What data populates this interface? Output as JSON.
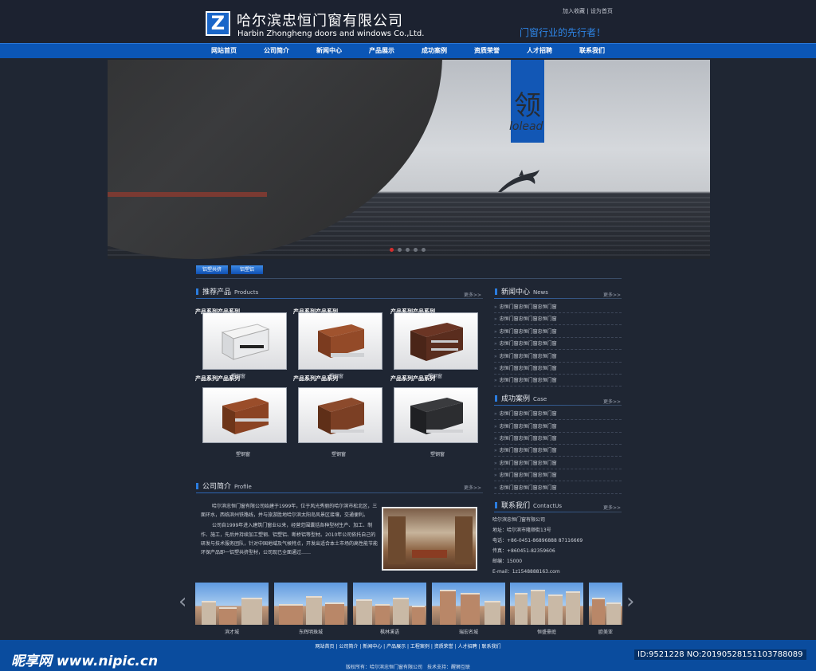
{
  "header": {
    "logo_letter": "Z",
    "company_cn": "哈尔滨忠恒门窗有限公司",
    "company_en": "Harbin Zhongheng doors and windows Co.,Ltd.",
    "top_link_1": "加入收藏",
    "top_link_sep": "|",
    "top_link_2": "设为首页",
    "slogan": "门窗行业的先行者！"
  },
  "nav": {
    "items": [
      "网站首页",
      "公司简介",
      "新闻中心",
      "产品展示",
      "成功案例",
      "资质荣誉",
      "人才招聘",
      "联系我们"
    ]
  },
  "banner": {
    "lead_glyph": "领",
    "lead_text": "lolead"
  },
  "tabs": [
    "铝塑共挤",
    "铝塑铝"
  ],
  "products": {
    "title": "推荐产品",
    "title_en": "Products",
    "more": "更多>>",
    "series_label": "产品系列产品系列",
    "items": [
      {
        "label": "产品系列产品系列",
        "caption": "塑钢窗"
      },
      {
        "label": "产品系列产品系列",
        "caption": "塑钢窗"
      },
      {
        "label": "产品系列产品系列",
        "caption": "塑钢窗"
      },
      {
        "label": "产品系列产品系列",
        "caption": "塑钢窗"
      },
      {
        "label": "产品系列产品系列",
        "caption": "塑钢窗"
      },
      {
        "label": "产品系列产品系列",
        "caption": "塑钢窗"
      }
    ]
  },
  "profile": {
    "title": "公司简介",
    "title_en": "Profile",
    "more": "更多>>",
    "para1": "哈尔滨忠恒门窗有限公司始建于1999年，位于风光秀丽的哈尔滨市松北区，三面环水，西临滨州铁路线，并与旅游胜地哈尔滨太阳岛风景区接壤，交通便利。",
    "para2": "公司自1999年进入建筑门窗业以来，经营范围囊括各种型材生产、加工、制作、施工，先后并持续加工塑钢、铝塑铝、断桥铝等型材。2010年公司依托自己的研发与技术服务团队，针对中国地域及气候特点，开发出适合本土市场的高性能节能环保产品即一铝塑共挤型材，公司现已全面通过……"
  },
  "news": {
    "title": "新闻中心",
    "title_en": "News",
    "more": "更多>>",
    "items": [
      "忠恒门窗忠恒门窗忠恒门窗",
      "忠恒门窗忠恒门窗忠恒门窗",
      "忠恒门窗忠恒门窗忠恒门窗",
      "忠恒门窗忠恒门窗忠恒门窗",
      "忠恒门窗忠恒门窗忠恒门窗",
      "忠恒门窗忠恒门窗忠恒门窗",
      "忠恒门窗忠恒门窗忠恒门窗",
      "忠恒门窗忠恒门窗忠恒门窗"
    ]
  },
  "cases": {
    "title": "成功案例",
    "title_en": "Case",
    "more": "更多>>",
    "items": [
      "忠恒门窗忠恒门窗忠恒门窗",
      "忠恒门窗忠恒门窗忠恒门窗",
      "忠恒门窗忠恒门窗忠恒门窗",
      "忠恒门窗忠恒门窗忠恒门窗",
      "忠恒门窗忠恒门窗忠恒门窗",
      "忠恒门窗忠恒门窗忠恒门窗",
      "忠恒门窗忠恒门窗忠恒门窗"
    ]
  },
  "contact": {
    "title": "联系我们",
    "title_en": "ContactUs",
    "more": "更多>>",
    "lines": [
      "哈尔滨忠恒门窗有限公司",
      "地址：哈尔滨市隆顺街13号",
      "电话：+86-0451-86896888 87116669",
      "传真：+860451-82359606",
      "邮编：15000",
      "E-mail：1z1548888163.com"
    ]
  },
  "case_strip": {
    "items": [
      "滨才城",
      "东辉明珠城",
      "枫林溪语",
      "瑞宏名城",
      "恒盛豪庭",
      "欧美亚"
    ]
  },
  "footer": {
    "nav": [
      "网站首页",
      "公司简介",
      "新闻中心",
      "产品展示",
      "工程案例",
      "资质荣誉",
      "人才招聘",
      "联系我们"
    ],
    "sep": " | ",
    "copyright": "版权所有：哈尔滨忠恒门窗有限公司　技术支持：醒狮互联"
  },
  "watermark": {
    "left": "昵享网 www.nipic.cn",
    "right": "ID:9521228 NO:20190528151103788089"
  }
}
